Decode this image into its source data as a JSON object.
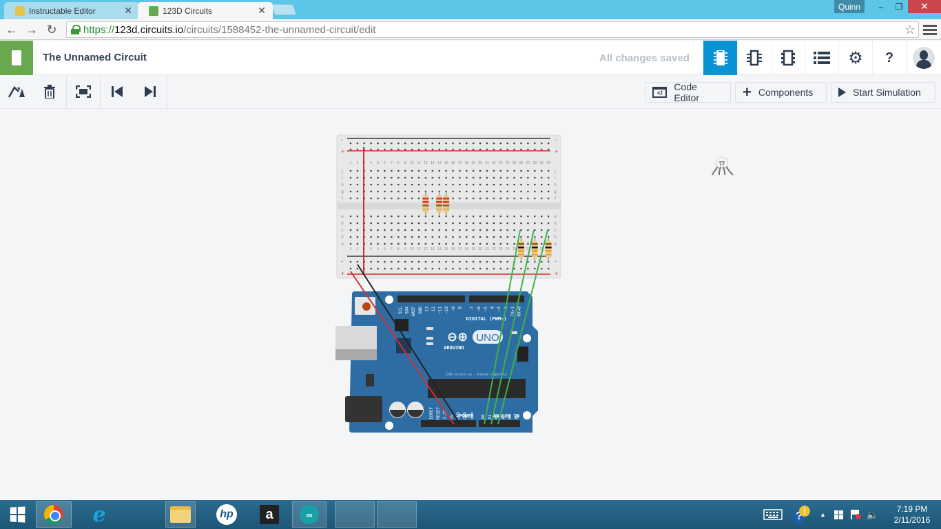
{
  "browser": {
    "tabs": [
      {
        "label": "Instructable Editor",
        "active": false,
        "favicon": "instructables-robot-icon"
      },
      {
        "label": "123D Circuits",
        "active": true,
        "favicon": "circuits-chip-icon"
      }
    ],
    "profile_name": "Quinn",
    "window_controls": {
      "minimize": "–",
      "maximize": "❐",
      "close": "✕"
    },
    "url": {
      "scheme": "https://",
      "host": "123d.circuits.io",
      "path": "/circuits/1588452-the-unnamed-circuit/edit"
    },
    "nav": {
      "back": "←",
      "forward": "→",
      "reload": "↻",
      "bookmark": "☆"
    }
  },
  "app": {
    "title": "The Unnamed Circuit",
    "save_status": "All changes saved",
    "header_buttons": [
      {
        "name": "breadboard-view",
        "icon": "breadboard-chip-icon",
        "active": true
      },
      {
        "name": "schematic-view",
        "icon": "schematic-chip-icon",
        "active": false
      },
      {
        "name": "pcb-view",
        "icon": "pcb-chip-icon",
        "active": false
      },
      {
        "name": "component-list",
        "icon": "list-icon",
        "active": false
      },
      {
        "name": "settings",
        "icon": "gear-icon",
        "active": false
      },
      {
        "name": "help",
        "icon": "help-icon",
        "label": "?",
        "active": false
      },
      {
        "name": "user-profile",
        "icon": "avatar-icon",
        "active": false
      }
    ],
    "toolbar": {
      "tools": [
        {
          "name": "rotate",
          "icon": "rotate-icon"
        },
        {
          "name": "delete",
          "icon": "trash-icon"
        },
        {
          "name": "fit-to-view",
          "icon": "fit-view-icon"
        },
        {
          "name": "previous",
          "icon": "skip-back-icon"
        },
        {
          "name": "next",
          "icon": "skip-forward-icon"
        }
      ],
      "code_editor_label": "Code Editor",
      "code_editor_icon_text": "</",
      "components_label": "Components",
      "start_simulation_label": "Start Simulation"
    }
  },
  "circuit": {
    "breadboard": {
      "columns": 30,
      "rows_top": [
        "j",
        "i",
        "h",
        "g",
        "f"
      ],
      "rows_bottom": [
        "e",
        "d",
        "c",
        "b",
        "a"
      ],
      "rail_minus": "-",
      "rail_plus": "+"
    },
    "resistors_top": [
      {
        "column": 12,
        "bands": [
          "#d33",
          "#d33",
          "#8b5a2b"
        ]
      },
      {
        "column": 14,
        "bands": [
          "#d33",
          "#d33",
          "#8b5a2b"
        ]
      },
      {
        "column": 15,
        "bands": [
          "#d33",
          "#d33",
          "#8b5a2b"
        ]
      }
    ],
    "resistors_bottom": [
      {
        "column": 26,
        "bands": [
          "#8b5a2b",
          "#111",
          "#f0a020"
        ]
      },
      {
        "column": 28,
        "bands": [
          "#8b5a2b",
          "#111",
          "#f0a020"
        ]
      },
      {
        "column": 30,
        "bands": [
          "#8b5a2b",
          "#111",
          "#f0a020"
        ]
      }
    ],
    "arduino": {
      "brand": "ARDUINO",
      "model": "UNO",
      "digital_pins": [
        "SCL",
        "SDA",
        "AREF",
        "GND",
        "13",
        "12",
        "~11",
        "~10",
        "~9",
        "8",
        "7",
        "~6",
        "~5",
        "4",
        "~3",
        "2",
        "TX▸1",
        "RX◂0"
      ],
      "digital_label": "DIGITAL (PWM~)",
      "power_label": "POWER",
      "power_pins": [
        "IOREF",
        "RESET",
        "3.3V",
        "5V",
        "GND",
        "GND",
        "Vin"
      ],
      "analog_label": "ANALOG IN",
      "analog_pins": [
        "A0",
        "A1",
        "A2",
        "A3",
        "A4",
        "A5"
      ],
      "led_labels": [
        "L",
        "TX",
        "RX",
        "ON"
      ],
      "footer_text": "123d.circuits.io - Arduino compatible"
    },
    "wire_colors": {
      "power": "#d32f2f",
      "ground": "#222222",
      "signal": "#3cb34a",
      "rail": "#d32f2f"
    },
    "loose_component": "rgb-led"
  },
  "taskbar": {
    "apps": [
      {
        "name": "start",
        "icon": "windows-logo-icon"
      },
      {
        "name": "chrome",
        "icon": "chrome-icon"
      },
      {
        "name": "internet-explorer",
        "icon": "ie-icon",
        "glyph": "e"
      },
      {
        "name": "file-explorer",
        "icon": "folder-icon"
      },
      {
        "name": "hp",
        "icon": "hp-icon",
        "glyph": "hp"
      },
      {
        "name": "amazon",
        "icon": "amazon-icon",
        "glyph": "a"
      },
      {
        "name": "arduino",
        "icon": "arduino-icon",
        "glyph": "∞"
      }
    ],
    "clock_time": "7:19 PM",
    "clock_date": "2/11/2016"
  }
}
